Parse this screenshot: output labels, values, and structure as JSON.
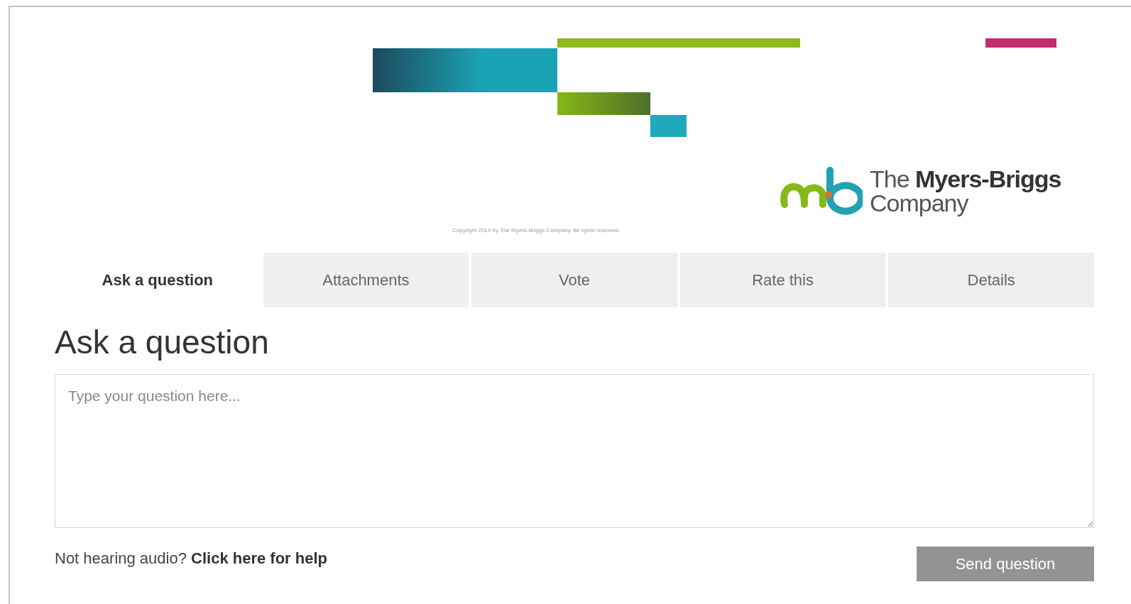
{
  "header": {
    "logo": {
      "line_1": "The **Myers-Briggs**",
      "line_2": "Company"
    },
    "copyright": "Copyright 2019 by The Myers-Briggs Company. All rights reserved."
  },
  "tabs": [
    {
      "label": "Ask a question",
      "selected": true
    },
    {
      "label": "Attachments",
      "selected": false
    },
    {
      "label": "Vote",
      "selected": false
    },
    {
      "label": "Rate this",
      "selected": false
    },
    {
      "label": "Details",
      "selected": false
    }
  ],
  "panel": {
    "heading": "Ask a question",
    "question_field": {
      "placeholder": "Type your question here..."
    },
    "help": {
      "text": "Not hearing audio?",
      "link": "Click here for help"
    },
    "send_button": {
      "label": "Send question",
      "disabled": true
    }
  }
}
